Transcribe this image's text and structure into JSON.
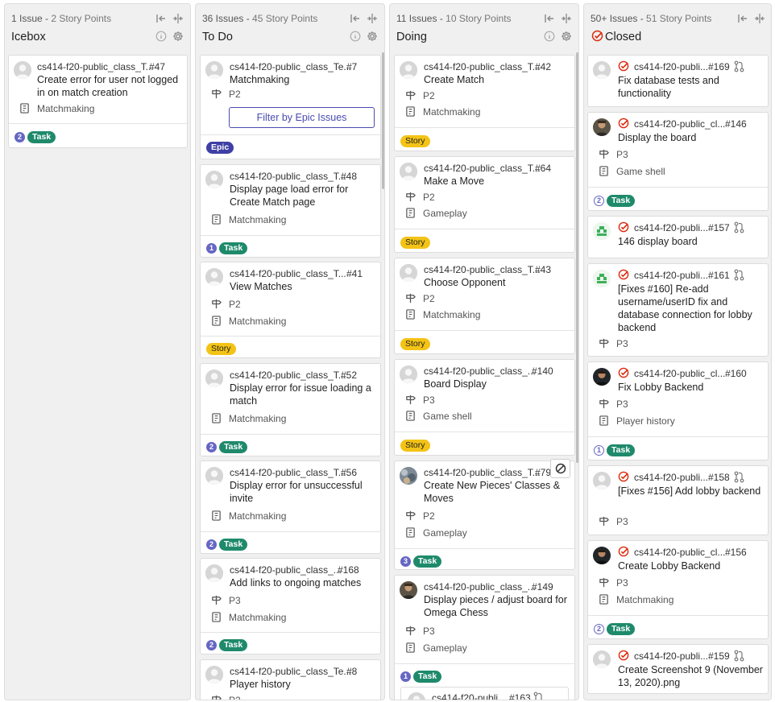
{
  "columns": {
    "icebox": {
      "issues": "1 Issue",
      "points": "2 Story Points",
      "title": "Icebox",
      "cards": [
        {
          "ref": "cs414-f20-public_class_T...",
          "num": "#47",
          "title": "Create error for user not logged in on match creation",
          "epic": "Matchmaking",
          "weight": "2",
          "label": "Task"
        }
      ]
    },
    "todo": {
      "issues": "36 Issues",
      "points": "45 Story Points",
      "title": "To Do",
      "cards": [
        {
          "ref": "cs414-f20-public_class_Te...",
          "num": "#7",
          "title": "Matchmaking",
          "priority": "P2",
          "button": "Filter by Epic Issues",
          "label": "Epic"
        },
        {
          "ref": "cs414-f20-public_class_T...",
          "num": "#48",
          "title": "Display page load error for Create Match page",
          "epic": "Matchmaking",
          "weight": "1",
          "label": "Task"
        },
        {
          "ref": "cs414-f20-public_class_T...",
          "num": "#41",
          "title": "View Matches",
          "priority": "P2",
          "epic": "Matchmaking",
          "label": "Story"
        },
        {
          "ref": "cs414-f20-public_class_T...",
          "num": "#52",
          "title": "Display error for issue loading a match",
          "epic": "Matchmaking",
          "weight": "2",
          "label": "Task"
        },
        {
          "ref": "cs414-f20-public_class_T...",
          "num": "#56",
          "title": "Display error for unsuccessful invite",
          "epic": "Matchmaking",
          "weight": "2",
          "label": "Task"
        },
        {
          "ref": "cs414-f20-public_class_...",
          "num": "#168",
          "title": "Add links to ongoing matches",
          "priority": "P3",
          "epic": "Matchmaking",
          "weight": "2",
          "label": "Task"
        },
        {
          "ref": "cs414-f20-public_class_Te...",
          "num": "#8",
          "title": "Player history",
          "priority": "P2"
        }
      ]
    },
    "doing": {
      "issues": "11 Issues",
      "points": "10 Story Points",
      "title": "Doing",
      "cards": [
        {
          "ref": "cs414-f20-public_class_T...",
          "num": "#42",
          "title": "Create Match",
          "priority": "P2",
          "epic": "Matchmaking",
          "label": "Story"
        },
        {
          "ref": "cs414-f20-public_class_T...",
          "num": "#64",
          "title": "Make a Move",
          "priority": "P2",
          "epic": "Gameplay",
          "label": "Story"
        },
        {
          "ref": "cs414-f20-public_class_T...",
          "num": "#43",
          "title": "Choose Opponent",
          "priority": "P2",
          "epic": "Matchmaking",
          "label": "Story"
        },
        {
          "ref": "cs414-f20-public_class_...",
          "num": "#140",
          "title": "Board Display",
          "priority": "P3",
          "epic": "Game shell",
          "label": "Story"
        },
        {
          "ref": "cs414-f20-public_class_T...",
          "num": "#79",
          "title": "Create New Pieces' Classes & Moves",
          "priority": "P2",
          "epic": "Gameplay",
          "weight": "3",
          "label": "Task"
        },
        {
          "ref": "cs414-f20-public_class_...",
          "num": "#149",
          "title": "Display pieces / adjust board for Omega Chess",
          "priority": "P3",
          "epic": "Gameplay",
          "weight": "1",
          "label": "Task"
        },
        {
          "ref": "cs414-f20-publi...",
          "num": "#163"
        }
      ]
    },
    "closed": {
      "issues": "50+ Issues",
      "points": "51 Story Points",
      "title": "Closed",
      "cards": [
        {
          "ref": "cs414-f20-publi...",
          "num": "#169",
          "title": "Fix database tests and functionality"
        },
        {
          "ref": "cs414-f20-public_cl...",
          "num": "#146",
          "title": "Display the board",
          "priority": "P3",
          "epic": "Game shell",
          "weight": "2",
          "label": "Task"
        },
        {
          "ref": "cs414-f20-publi...",
          "num": "#157",
          "title": "146 display board"
        },
        {
          "ref": "cs414-f20-publi...",
          "num": "#161",
          "title": "[Fixes #160] Re-add username/userID fix and database connection for lobby backend",
          "priority": "P3"
        },
        {
          "ref": "cs414-f20-public_cl...",
          "num": "#160",
          "title": "Fix Lobby Backend",
          "priority": "P3",
          "epic": "Player history",
          "weight": "1",
          "label": "Task"
        },
        {
          "ref": "cs414-f20-publi...",
          "num": "#158",
          "title": "[Fixes #156] Add lobby backend",
          "priority": "P3"
        },
        {
          "ref": "cs414-f20-public_cl...",
          "num": "#156",
          "title": "Create Lobby Backend",
          "priority": "P3",
          "epic": "Matchmaking",
          "weight": "2",
          "label": "Task"
        },
        {
          "ref": "cs414-f20-publi...",
          "num": "#159",
          "title": "Create Screenshot 9 (November 13, 2020).png"
        }
      ]
    }
  },
  "colors": {
    "task": "#1f8a6b",
    "story": "#f3c316",
    "epic": "#3f3fa6",
    "weight": "#6666c4",
    "closed": "#dd2b0e"
  },
  "icons": [
    "collapse-left-icon",
    "collapse-icon",
    "info-icon",
    "gear-icon",
    "closed-issue-icon",
    "priority-signpost-icon",
    "epic-board-icon",
    "merge-request-icon",
    "blocked-icon"
  ]
}
